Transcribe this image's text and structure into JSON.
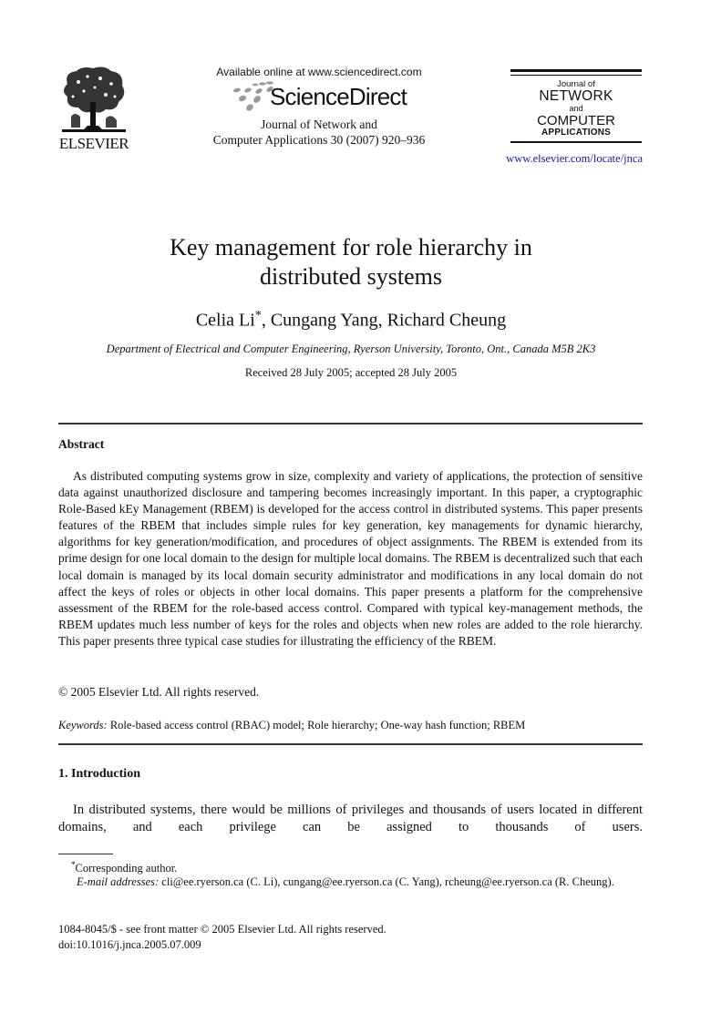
{
  "header": {
    "publisher_logo_text": "ELSEVIER",
    "publisher_logo_icon": "elsevier-tree-icon",
    "available_online": "Available online at www.sciencedirect.com",
    "platform_name": "ScienceDirect",
    "platform_logo_icon": "sciencedirect-dots-icon",
    "journal_citation_line1": "Journal of Network and",
    "journal_citation_line2": "Computer Applications 30 (2007) 920–936",
    "journal_mark": {
      "line1": "Journal of",
      "line2": "NETWORK",
      "line3": "and",
      "line4": "COMPUTER",
      "line5": "APPLICATIONS"
    },
    "journal_url": "www.elsevier.com/locate/jnca",
    "link_color": "#1a1aa6"
  },
  "article": {
    "title_line1": "Key management for role hierarchy in",
    "title_line2": "distributed systems",
    "authors": [
      {
        "name": "Celia Li",
        "marker": "*"
      },
      {
        "name": "Cungang Yang",
        "marker": ""
      },
      {
        "name": "Richard Cheung",
        "marker": ""
      }
    ],
    "affiliation": "Department of Electrical and Computer Engineering, Ryerson University, Toronto, Ont., Canada M5B 2K3",
    "received": "Received 28 July 2005; accepted 28 July 2005"
  },
  "abstract": {
    "heading": "Abstract",
    "body": "As distributed computing systems grow in size, complexity and variety of applications, the protection of sensitive data against unauthorized disclosure and tampering becomes increasingly important. In this paper, a cryptographic Role-Based kEy Management (RBEM) is developed for the access control in distributed systems. This paper presents features of the RBEM that includes simple rules for key generation, key managements for dynamic hierarchy, algorithms for key generation/modification, and procedures of object assignments. The RBEM is extended from its prime design for one local domain to the design for multiple local domains. The RBEM is decentralized such that each local domain is managed by its local domain security administrator and modifications in any local domain do not affect the keys of roles or objects in other local domains. This paper presents a platform for the comprehensive assessment of the RBEM for the role-based access control. Compared with typical key-management methods, the RBEM updates much less number of keys for the roles and objects when new roles are added to the role hierarchy. This paper presents three typical case studies for illustrating the efficiency of the RBEM.",
    "copyright": "© 2005 Elsevier Ltd. All rights reserved."
  },
  "keywords": {
    "label": "Keywords:",
    "value": "Role-based access control (RBAC) model; Role hierarchy; One-way hash function; RBEM"
  },
  "introduction": {
    "heading": "1.  Introduction",
    "body": "In distributed systems, there would be millions of privileges and thousands of users located in different domains, and each privilege can be assigned to thousands of users."
  },
  "footnotes": {
    "corresponding_marker": "*",
    "corresponding_text": "Corresponding author.",
    "email_label": "E-mail addresses:",
    "email_value": "cli@ee.ryerson.ca (C. Li), cungang@ee.ryerson.ca (C. Yang), rcheung@ee.ryerson.ca (R. Cheung)."
  },
  "front_matter": {
    "issn_line": "1084-8045/$ - see front matter © 2005 Elsevier Ltd. All rights reserved.",
    "doi_line": "doi:10.1016/j.jnca.2005.07.009"
  }
}
